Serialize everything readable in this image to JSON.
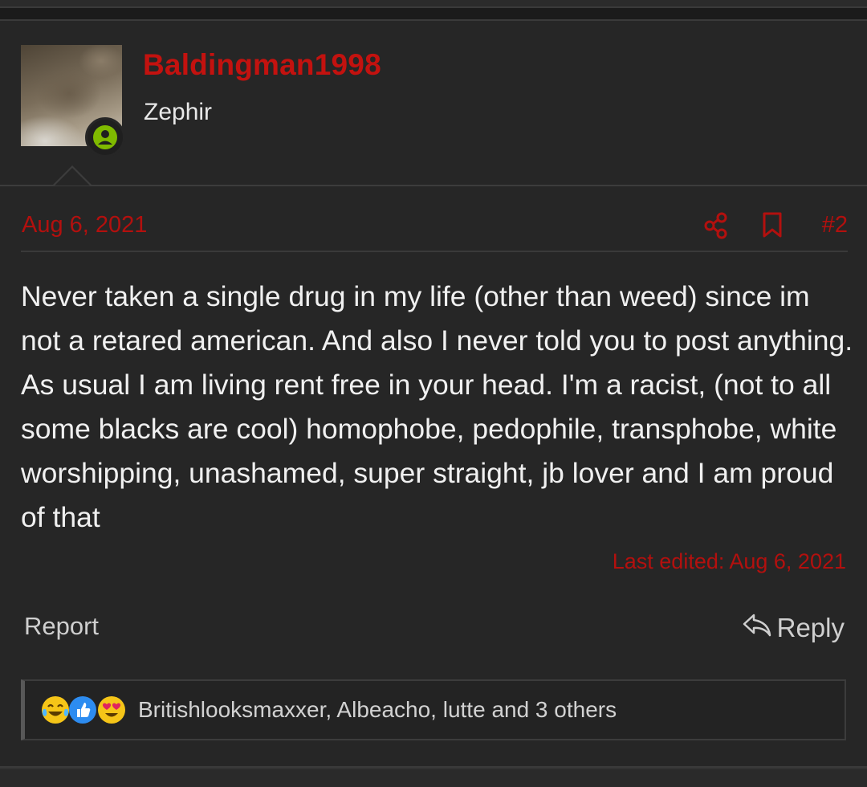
{
  "post": {
    "username": "Baldingman1998",
    "user_title": "Zephir",
    "date": "Aug 6, 2021",
    "post_number": "#2",
    "message": "Never taken a single drug in my life (other than weed) since im not a retared american. And also I never told you to post anything. As usual I am living rent free in your head. I'm a racist, (not to all some blacks are cool) homophobe, pedophile, transphobe, white worshipping, unashamed, super straight, jb lover and I am proud of that",
    "last_edited": "Last edited: Aug 6, 2021",
    "report_label": "Report",
    "reply_label": "Reply",
    "reactions": {
      "icons": [
        "crying-laughing-emoji",
        "thumbs-up-emoji",
        "heart-eyes-emoji"
      ],
      "names": "Britishlooksmaxxer, Albeacho, lutte and 3 others"
    }
  },
  "colors": {
    "username": "#c3120f",
    "accent_red": "#b3100e",
    "background": "#262626",
    "online_green": "#7fba00"
  }
}
